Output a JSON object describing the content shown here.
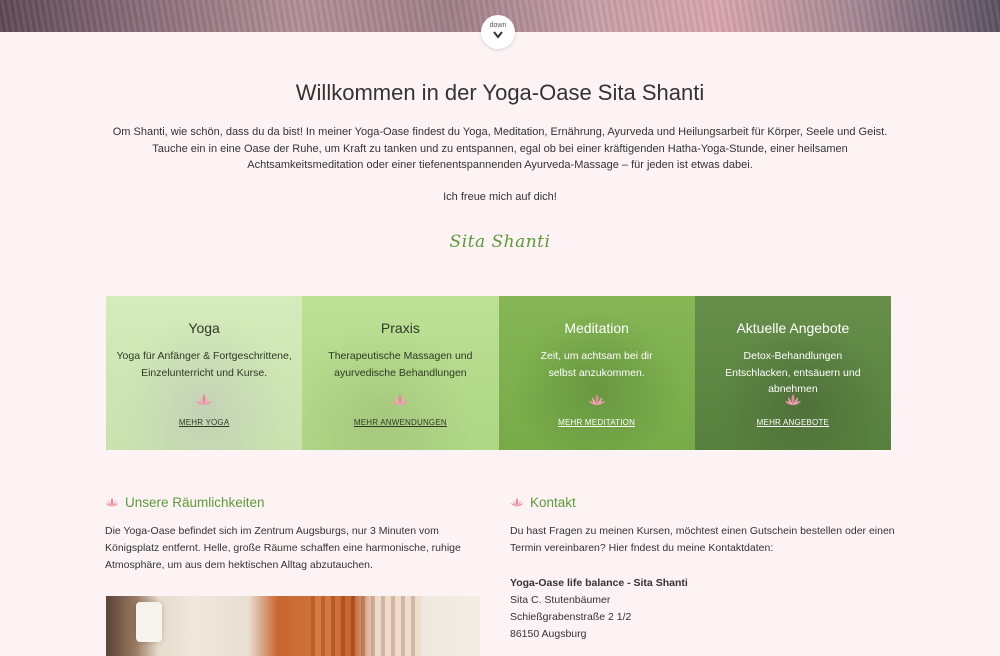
{
  "hero": {
    "down_label": "down"
  },
  "welcome": {
    "title": "Willkommen in der Yoga-Oase Sita Shanti",
    "intro": "Om Shanti, wie schön, dass du da bist! In meiner Yoga-Oase findest du Yoga, Meditation, Ernährung, Ayurveda und Heilungsarbeit für Körper, Seele und Geist. Tauche ein in eine Oase der Ruhe, um Kraft zu tanken und zu entspannen, egal ob bei einer kräftigenden Hatha-Yoga-Stunde, einer heilsamen Achtsamkeitsmeditation oder einer tiefenentspannenden Ayurveda-Massage – für jeden ist etwas dabei.",
    "greeting": "Ich freue mich auf dich!",
    "signature": "Sita Shanti"
  },
  "tiles": [
    {
      "title": "Yoga",
      "line1": "Yoga für Anfänger & Fortgeschrittene,",
      "line2": "Einzelunterricht und Kurse.",
      "link": "MEHR YOGA"
    },
    {
      "title": "Praxis",
      "line1": "Therapeutische Massagen und",
      "line2": "ayurvedische Behandlungen",
      "link": "MEHR ANWENDUNGEN"
    },
    {
      "title": "Meditation",
      "line1": "Zeit, um achtsam bei dir",
      "line2": "selbst anzukommen.",
      "link": "MEHR MEDITATION"
    },
    {
      "title": "Aktuelle Angebote",
      "line1": "Detox-Behandlungen",
      "line2": "Entschlacken, entsäuern und abnehmen",
      "link": "MEHR ANGEBOTE"
    }
  ],
  "rooms": {
    "heading": "Unsere Räumlichkeiten",
    "text": "Die Yoga-Oase befindet sich im Zentrum Augsburgs, nur 3 Minuten vom Königsplatz entfernt. Helle, große Räume schaffen eine harmonische, ruhige Atmosphäre, um aus dem hektischen Alltag abzutauchen."
  },
  "contact": {
    "heading": "Kontakt",
    "text": "Du hast Fragen zu meinen Kursen, möchtest einen Gutschein bestellen oder einen Termin vereinbaren? Hier fndest du meine Kontaktdaten:",
    "name": "Yoga-Oase life balance - Sita Shanti",
    "person": "Sita C. Stutenbäumer",
    "street": "Schießgrabenstraße 2 1/2",
    "city": "86150 Augsburg"
  },
  "colors": {
    "accent_green": "#5d9a3a",
    "background": "#fdf3f4",
    "lotus": "#e6889a"
  }
}
